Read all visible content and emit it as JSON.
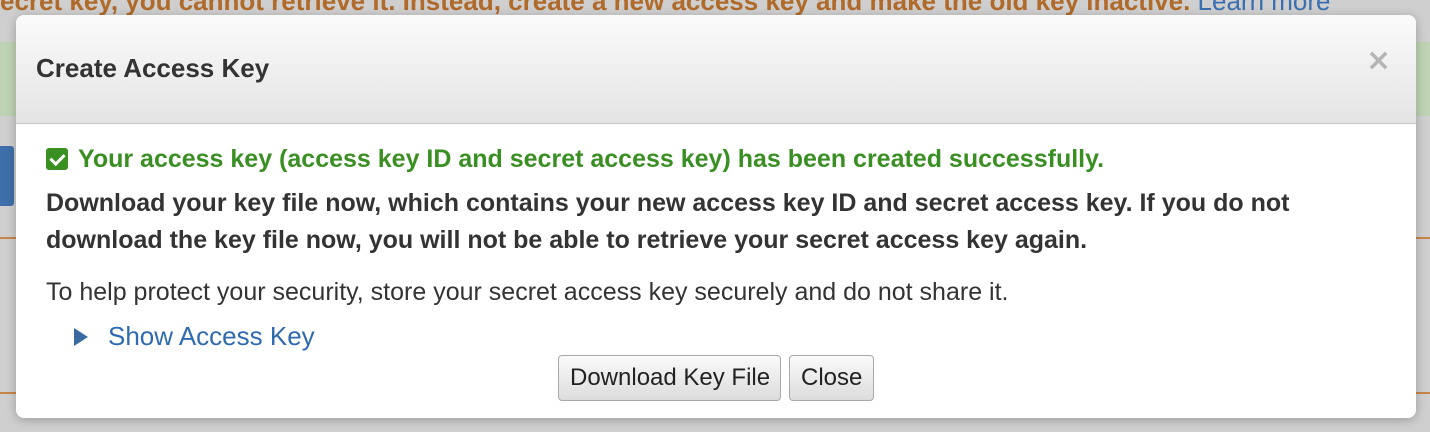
{
  "background": {
    "top_text": "ecret key, you cannot retrieve it. Instead, create a new access key and make the old key inactive.",
    "top_link": "Learn more"
  },
  "modal": {
    "title": "Create Access Key",
    "close_glyph": "×",
    "success_message": "Your access key (access key ID and secret access key) has been created successfully.",
    "warning_message": "Download your key file now, which contains your new access key ID and secret access key. If you do not download the key file now, you will not be able to retrieve your secret access key again.",
    "help_text": "To help protect your security, store your secret access key securely and do not share it.",
    "show_key_label": "Show Access Key",
    "buttons": {
      "download": "Download Key File",
      "close": "Close"
    }
  },
  "colors": {
    "success": "#3a8f23",
    "link": "#2f6bb0",
    "text": "#333333"
  },
  "icons": {
    "success": "check-square-icon",
    "disclosure": "triangle-right-icon",
    "close": "close-icon"
  }
}
